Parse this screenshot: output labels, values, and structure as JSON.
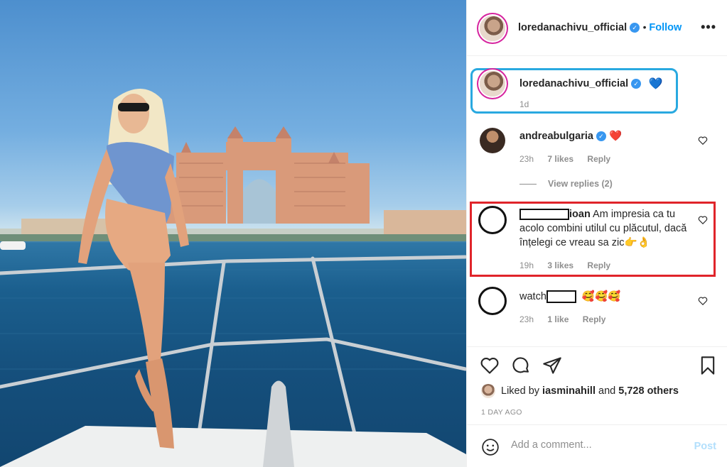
{
  "post": {
    "username": "loredanachivu_official",
    "follow_label": "Follow",
    "more_icon": "more-options-icon"
  },
  "caption": {
    "username": "loredanachivu_official",
    "emoji": "💙",
    "time": "1d"
  },
  "comments": [
    {
      "username": "andreabulgaria",
      "text": "❤️",
      "time": "23h",
      "likes": "7 likes",
      "reply": "Reply"
    },
    {
      "username_visible": "ioan",
      "text": "Am impresia ca tu acolo combini utilul cu plăcutul, dacă înțelegi ce vreau sa zic👉👌",
      "time": "19h",
      "likes": "3 likes",
      "reply": "Reply"
    },
    {
      "username_visible": "watch",
      "text": "🥰🥰🥰",
      "time": "23h",
      "likes": "1 like",
      "reply": "Reply"
    }
  ],
  "view_replies": "View replies (2)",
  "actions": {
    "liked_by_prefix": "Liked by",
    "liked_by_user": "iasminahill",
    "liked_by_and": "and",
    "liked_by_count": "5,728 others",
    "time_ago": "1 DAY AGO"
  },
  "add_comment": {
    "placeholder": "Add a comment...",
    "post_label": "Post"
  },
  "colors": {
    "accent": "#0095f6",
    "annotation_blue": "#29a9e0",
    "annotation_red": "#e0242a"
  }
}
